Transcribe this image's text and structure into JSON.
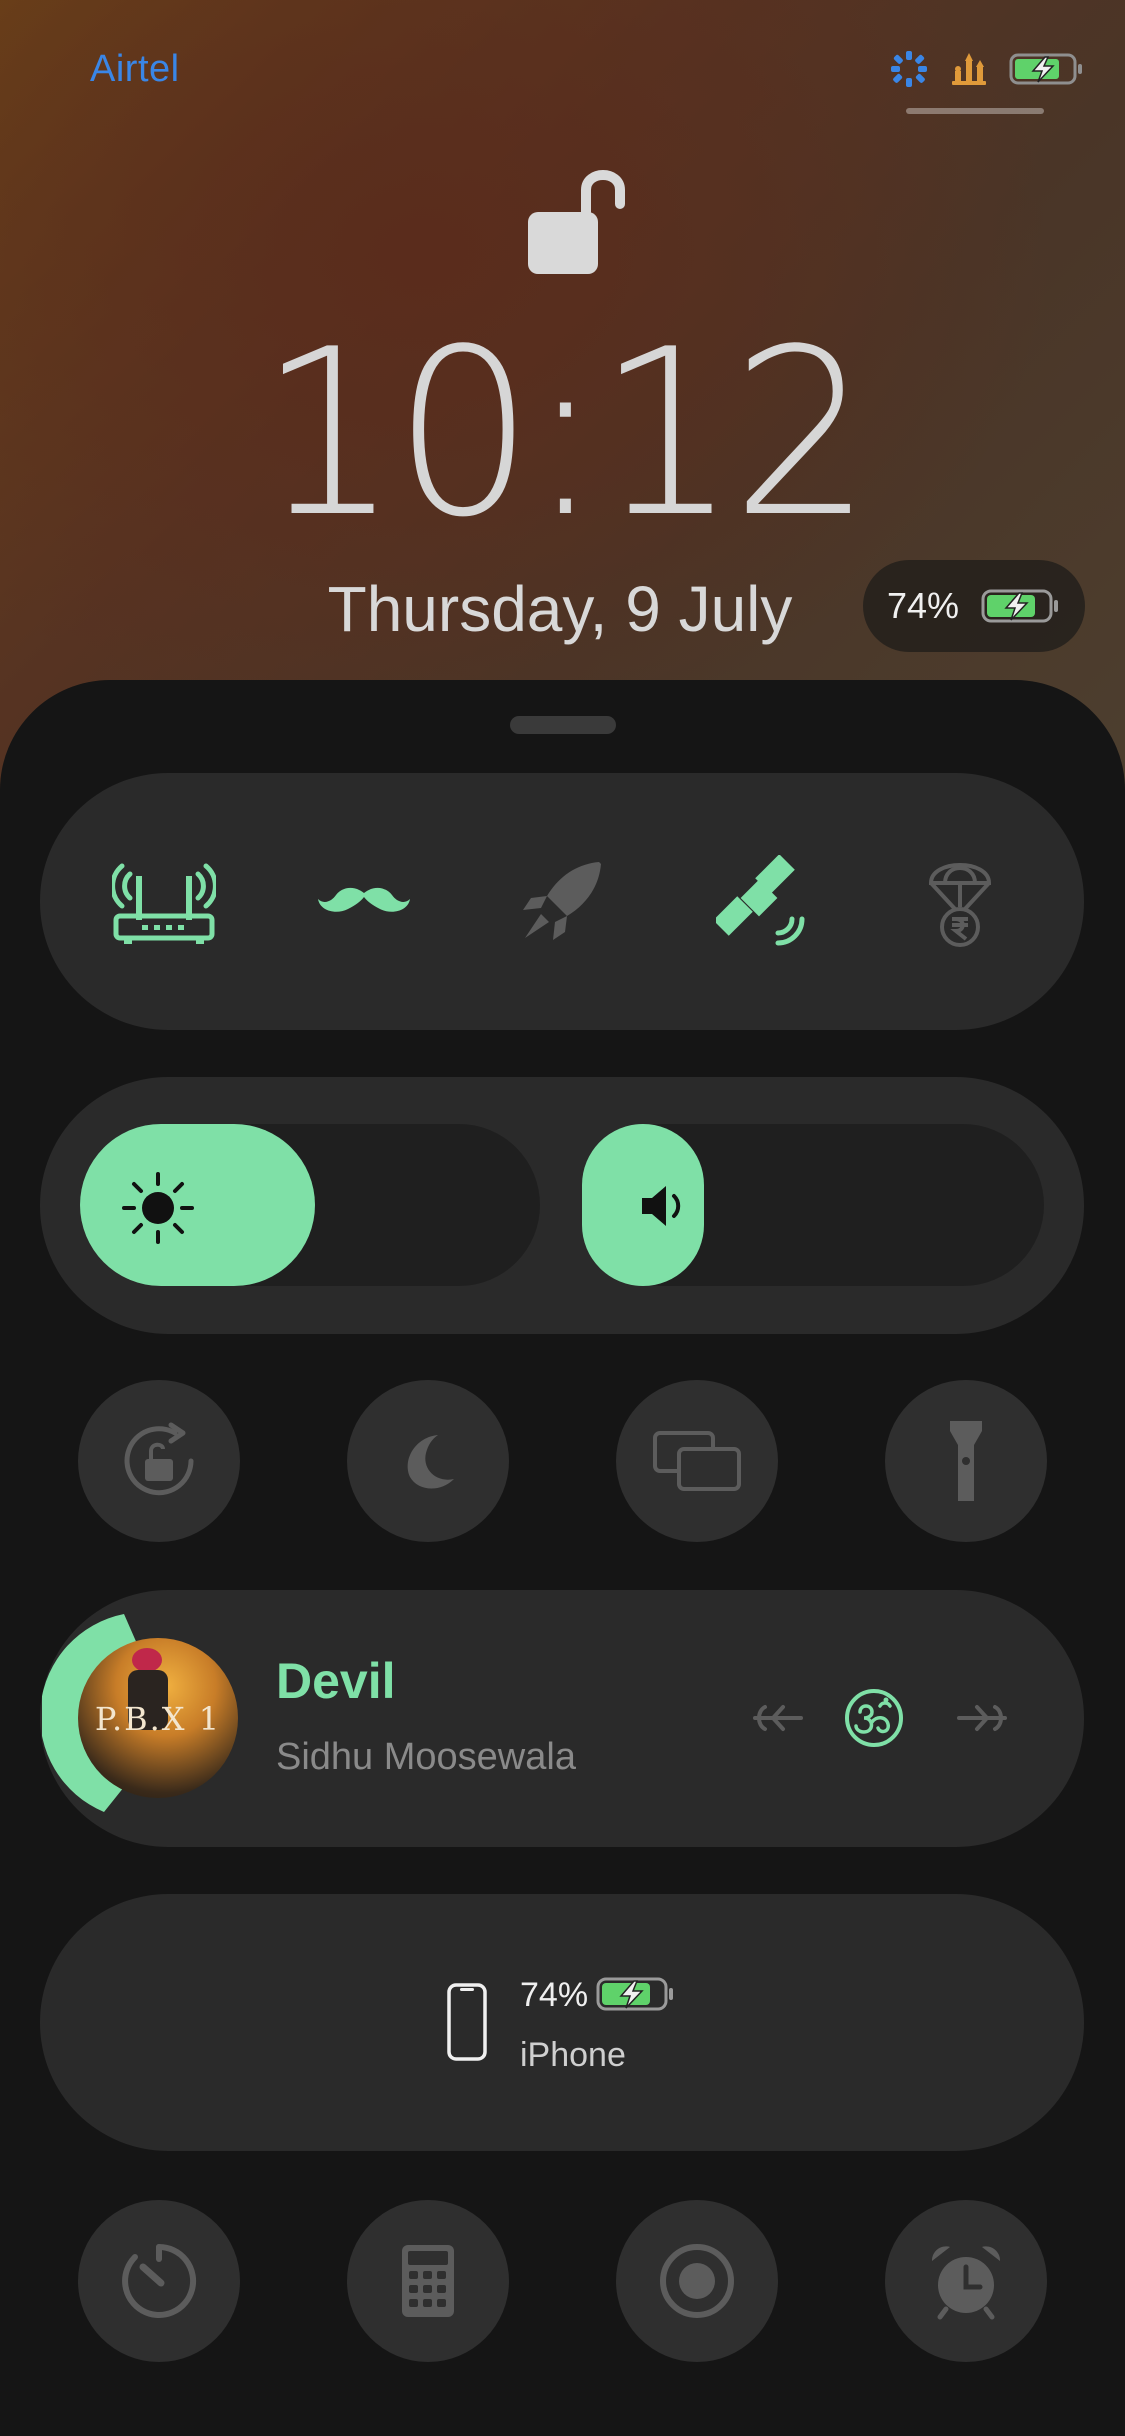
{
  "status_bar": {
    "carrier": "Airtel",
    "icons": [
      "loading-ring-icon",
      "chess-icon",
      "battery-charging-icon"
    ]
  },
  "lock_screen": {
    "lock_state": "unlocked",
    "time": "10:12",
    "date": "Thursday, 9 July",
    "battery_percent": "74%"
  },
  "control_center": {
    "connectivity": [
      {
        "name": "wifi-router",
        "active": true
      },
      {
        "name": "mustache",
        "active": true
      },
      {
        "name": "rocket",
        "active": false
      },
      {
        "name": "satellite",
        "active": true
      },
      {
        "name": "rupee-parachute",
        "active": false
      }
    ],
    "sliders": {
      "brightness": {
        "icon": "sun-icon",
        "level": 0.51
      },
      "volume": {
        "icon": "speaker-icon",
        "level": 0.26
      }
    },
    "toggles_row1": [
      "rotation-lock-icon",
      "moon-icon",
      "screen-mirroring-icon",
      "flashlight-icon"
    ],
    "now_playing": {
      "title": "Devil",
      "artist": "Sidhu Moosewala",
      "album_art_text": "P.B.X 1",
      "progress": 0.35,
      "controls": [
        "previous-icon",
        "om-icon",
        "next-icon"
      ]
    },
    "device_battery": {
      "percent": "74%",
      "device": "iPhone"
    },
    "toggles_row2": [
      "timer-icon",
      "calculator-icon",
      "record-icon",
      "alarm-icon"
    ]
  },
  "colors": {
    "accent_green": "#7fe0a7",
    "carrier_blue": "#3a86e6",
    "inactive_icon": "#5c5c5c",
    "panel": "#2a2a2a"
  }
}
